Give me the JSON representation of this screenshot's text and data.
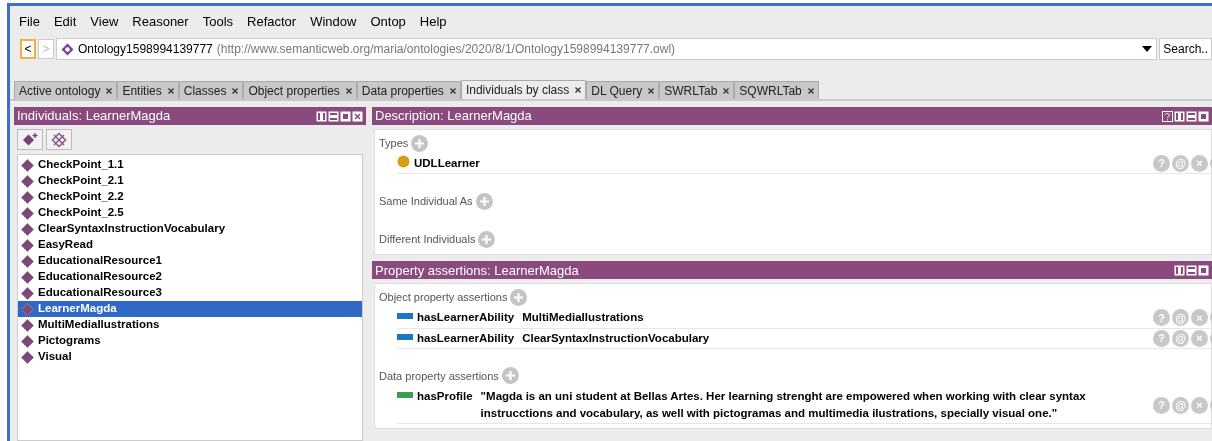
{
  "menu": [
    "File",
    "Edit",
    "View",
    "Reasoner",
    "Tools",
    "Refactor",
    "Window",
    "Ontop",
    "Help"
  ],
  "nav": {
    "back": {
      "label": "<",
      "disabled": false
    },
    "forward": {
      "label": ">",
      "disabled": true
    }
  },
  "address": {
    "name": "Ontology1598994139777",
    "iri": "(http://www.semanticweb.org/maria/ontologies/2020/8/1/Ontology1598994139777.owl)"
  },
  "search_button": "Search..",
  "tabs": [
    {
      "label": "Active ontology",
      "selected": false
    },
    {
      "label": "Entities",
      "selected": false
    },
    {
      "label": "Classes",
      "selected": false
    },
    {
      "label": "Object properties",
      "selected": false
    },
    {
      "label": "Data properties",
      "selected": false
    },
    {
      "label": "Individuals by class",
      "selected": true
    },
    {
      "label": "DL Query",
      "selected": false
    },
    {
      "label": "SWRLTab",
      "selected": false
    },
    {
      "label": "SQWRLTab",
      "selected": false
    }
  ],
  "individuals_panel": {
    "title": "Individuals: LearnerMagda",
    "items": [
      {
        "label": "CheckPoint_1.1",
        "selected": false
      },
      {
        "label": "CheckPoint_2.1",
        "selected": false
      },
      {
        "label": "CheckPoint_2.2",
        "selected": false
      },
      {
        "label": "CheckPoint_2.5",
        "selected": false
      },
      {
        "label": "ClearSyntaxInstructionVocabulary",
        "selected": false
      },
      {
        "label": "EasyRead",
        "selected": false
      },
      {
        "label": "EducationalResource1",
        "selected": false
      },
      {
        "label": "EducationalResource2",
        "selected": false
      },
      {
        "label": "EducationalResource3",
        "selected": false
      },
      {
        "label": "LearnerMagda",
        "selected": true
      },
      {
        "label": "MultiMediaIlustrations",
        "selected": false
      },
      {
        "label": "Pictograms",
        "selected": false
      },
      {
        "label": "Visual",
        "selected": false
      }
    ]
  },
  "description_panel": {
    "title": "Description: LearnerMagda",
    "sections": [
      {
        "label": "Types",
        "items": [
          {
            "kind": "class",
            "text": "UDLLearner",
            "actions": [
              "?",
              "@",
              "×"
            ]
          }
        ]
      },
      {
        "label": "Same Individual As"
      },
      {
        "label": "Different Individuals"
      }
    ]
  },
  "property_panel": {
    "title": "Property assertions: LearnerMagda",
    "sections": [
      {
        "label": "Object property assertions",
        "items": [
          {
            "kind": "object",
            "property": "hasLearnerAbility",
            "value": "MultiMediaIlustrations",
            "actions": [
              "?",
              "@",
              "×"
            ]
          },
          {
            "kind": "object",
            "property": "hasLearnerAbility",
            "value": "ClearSyntaxInstructionVocabulary",
            "actions": [
              "?",
              "@",
              "×"
            ]
          }
        ]
      },
      {
        "label": "Data property assertions",
        "items": [
          {
            "kind": "data",
            "property": "hasProfile",
            "value": "\"Magda is an uni student at Bellas Artes. Her learning strenght are empowered when working with clear syntax instrucctions and vocabulary, as well with pictogramas and multimedia ilustrations, specially visual one.\"",
            "actions": [
              "?",
              "@",
              "×"
            ]
          }
        ]
      }
    ]
  }
}
